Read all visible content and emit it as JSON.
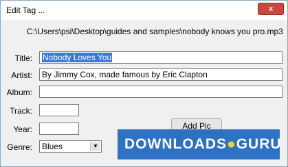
{
  "window": {
    "title": "Edit Tag ...",
    "close_symbol": "x",
    "file_path": "C:\\Users\\psi\\Desktop\\guides and samples\\nobody knows you pro.mp3"
  },
  "fields": {
    "title_label": "Title:",
    "title_value": "Nobody Loves You",
    "artist_label": "Artist:",
    "artist_value": "By Jimmy Cox, made famous by Eric Clapton",
    "album_label": "Album:",
    "album_value": "",
    "track_label": "Track:",
    "track_value": "",
    "year_label": "Year:",
    "year_value": "",
    "genre_label": "Genre:",
    "genre_value": "Blues"
  },
  "buttons": {
    "add_pic": "Add Pic"
  },
  "watermark": {
    "text_left": "DOWNLOADS",
    "dot": "●",
    "text_right": "GURU"
  },
  "colors": {
    "selection": "#3c78d8",
    "close_button": "#c94a3d",
    "watermark_bg": "#1f68c1"
  }
}
